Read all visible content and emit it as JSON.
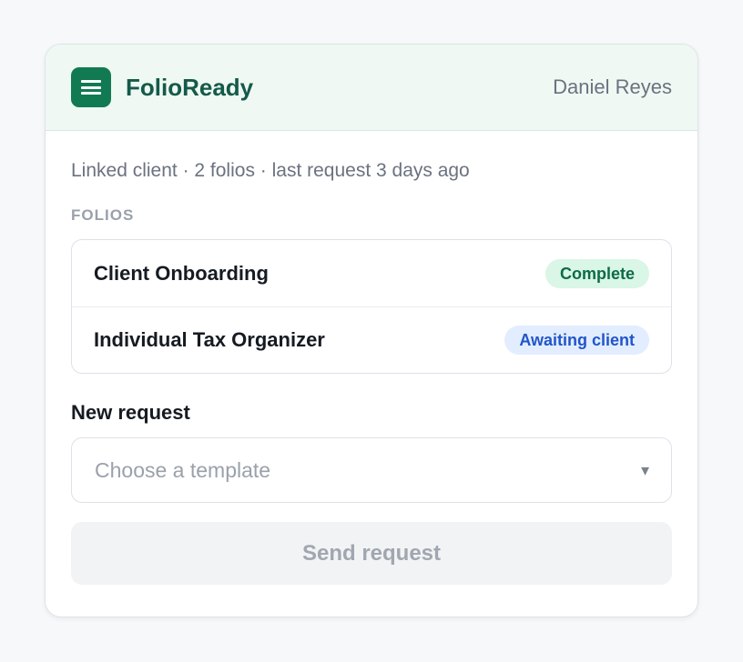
{
  "header": {
    "app_name": "FolioReady",
    "user_name": "Daniel Reyes",
    "logo_icon": "menu-lines-icon",
    "brand_color": "#117a52"
  },
  "summary": {
    "meta_text": "Linked client · 2 folios · last request 3 days ago"
  },
  "folios": {
    "section_label": "FOLIOS",
    "items": [
      {
        "name": "Client Onboarding",
        "status": "Complete",
        "status_color": "#0d6b47"
      },
      {
        "name": "Individual Tax Organizer",
        "status": "Awaiting client",
        "status_color": "#2155c9"
      }
    ]
  },
  "new_request": {
    "label": "New request",
    "template_select": {
      "placeholder": "Choose a template",
      "chevron_icon": "chevron-down-icon",
      "chevron_glyph": "▾"
    },
    "send_label": "Send request"
  }
}
